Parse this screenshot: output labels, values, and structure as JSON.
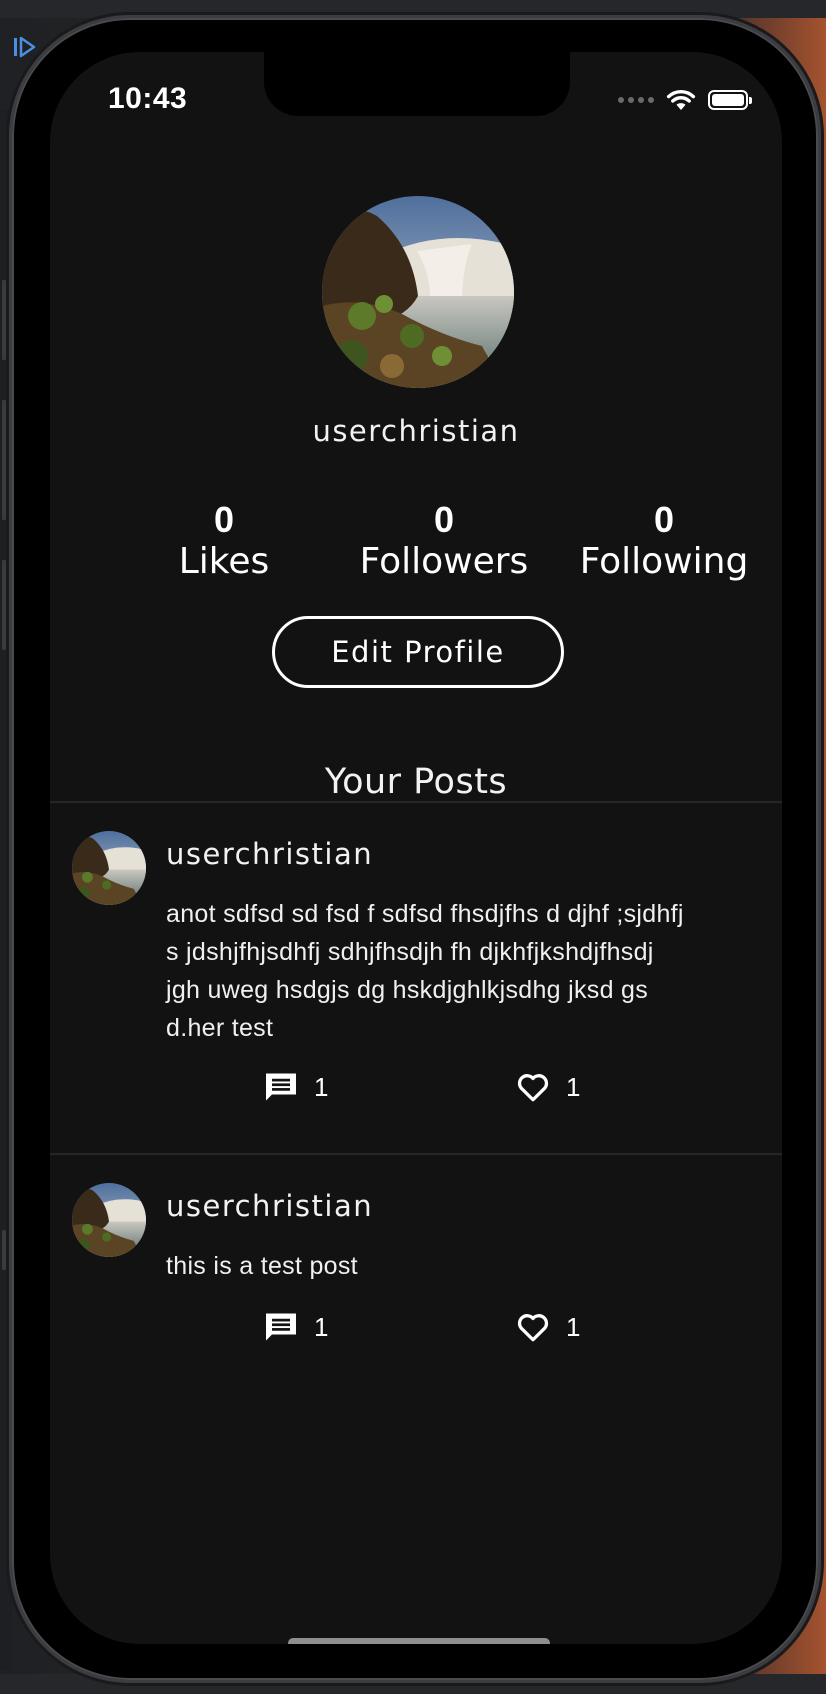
{
  "status_bar": {
    "time": "10:43",
    "icons": [
      "signal-dots-icon",
      "wifi-icon",
      "battery-icon"
    ]
  },
  "profile": {
    "avatar": "waterfall-landscape-photo",
    "username": "userchristian",
    "stats": [
      {
        "count": "0",
        "label": "Likes"
      },
      {
        "count": "0",
        "label": "Followers"
      },
      {
        "count": "0",
        "label": "Following"
      }
    ],
    "edit_button_label": "Edit Profile"
  },
  "posts_section": {
    "title": "Your Posts"
  },
  "posts": [
    {
      "username": "userchristian",
      "text": "anot sdfsd sd fsd f sdfsd fhsdjfhs d djhf ;sjdhfj s jdshjfhjsdhfj sdhjfhsdjh fh djkhfjkshdjfhsdj jgh uweg hsdgjs dg hskdjghlkjsdhg jksd gs d.her test",
      "comment_count": "1",
      "like_count": "1"
    },
    {
      "username": "userchristian",
      "text": "this is a test post",
      "comment_count": "1",
      "like_count": "1"
    }
  ],
  "colors": {
    "screen_background": "#121212",
    "text": "#ffffff",
    "divider": "#262626"
  }
}
